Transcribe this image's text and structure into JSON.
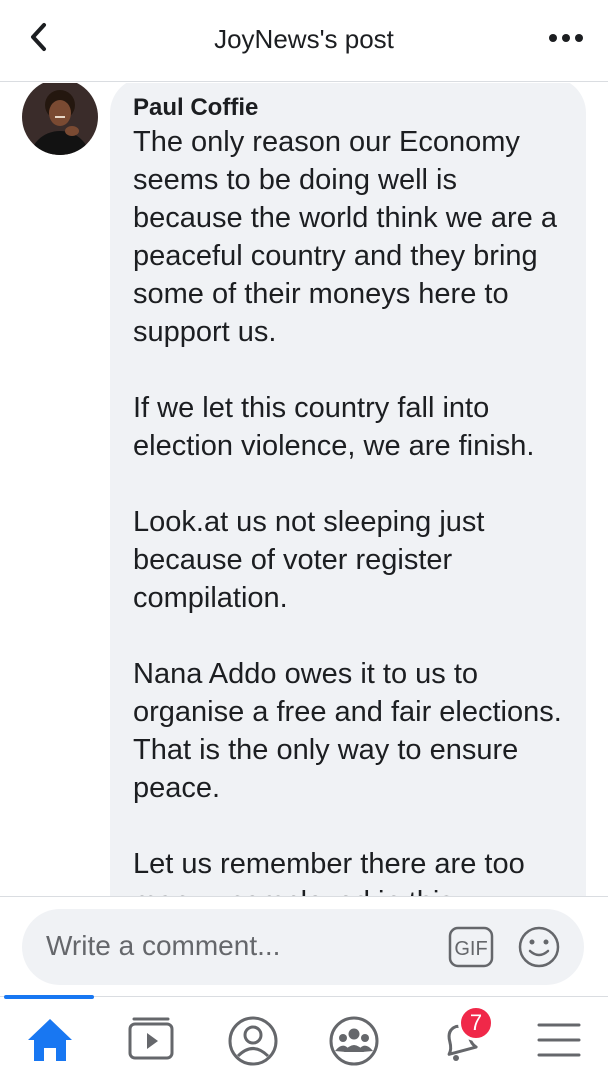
{
  "header": {
    "title": "JoyNews's post",
    "back_icon": "chevron-left-icon",
    "more_icon": "more-horizontal-icon"
  },
  "comment": {
    "author": "Paul Coffie",
    "paragraphs": [
      "The only reason our Economy seems to be doing well is because the world think we are a peaceful country and they bring some of their moneys here to support us.",
      "If we let this country fall into election violence, we are finish.",
      "Look.at us not sleeping just because of voter register compilation.",
      "Nana Addo owes it to us to organise a free and fair elections. That is the only way to ensure peace.",
      "Let us remember there are too many unemployed in this"
    ]
  },
  "composer": {
    "placeholder": "Write a comment...",
    "gif_label": "GIF",
    "emoji_icon": "smiley-icon"
  },
  "nav": {
    "items": [
      "home-icon",
      "watch-video-icon",
      "profile-icon",
      "groups-icon",
      "notifications-bell-icon",
      "menu-hamburger-icon"
    ],
    "notification_count": "7",
    "accent_color": "#1877f2",
    "badge_color": "#f02849"
  }
}
